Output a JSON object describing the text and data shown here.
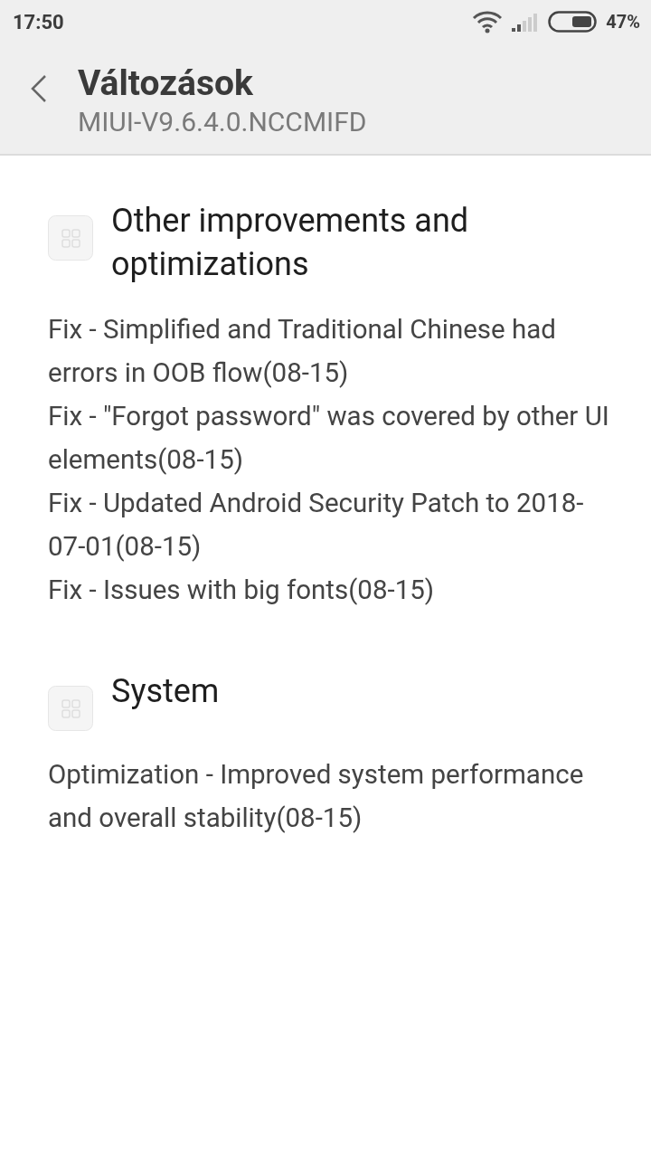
{
  "status_bar": {
    "time": "17:50",
    "battery": "47%"
  },
  "header": {
    "title": "Változások",
    "subtitle": "MIUI-V9.6.4.0.NCCMIFD"
  },
  "sections": [
    {
      "title": "Other improvements and optimizations",
      "items": [
        "Fix - Simplified and Traditional Chinese had errors in OOB flow(08-15)",
        "Fix - \"Forgot password\" was covered by other UI elements(08-15)",
        "Fix - Updated Android Security Patch to 2018-07-01(08-15)",
        "Fix - Issues with big fonts(08-15)"
      ]
    },
    {
      "title": "System",
      "items": [
        "Optimization - Improved system performance and overall stability(08-15)"
      ]
    }
  ]
}
